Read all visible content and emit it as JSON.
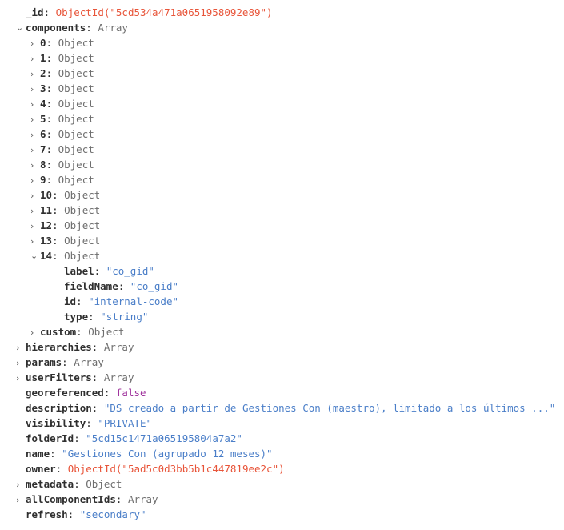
{
  "viewer": {
    "name": "object-tree-inspector",
    "background": "#ffffff",
    "colors": {
      "key": "#2f2f2f",
      "type_label": "#6e6e6e",
      "string": "#4a7ec8",
      "objectid": "#e8553a",
      "boolean": "#a0349e",
      "twisty": "#5a5a5a"
    },
    "icons": {
      "collapsed": "›",
      "expanded": "⌄"
    }
  },
  "rows": [
    {
      "indent": 1,
      "twisty": "none",
      "key": "_id",
      "colon": ":",
      "value": "ObjectId(\"5cd534a471a0651958092e89\")",
      "kind": "oid"
    },
    {
      "indent": 1,
      "twisty": "expanded",
      "key": "components",
      "colon": ":",
      "value": "Array",
      "kind": "type"
    },
    {
      "indent": 2,
      "twisty": "collapsed",
      "key": "0",
      "colon": ":",
      "value": "Object",
      "kind": "type"
    },
    {
      "indent": 2,
      "twisty": "collapsed",
      "key": "1",
      "colon": ":",
      "value": "Object",
      "kind": "type"
    },
    {
      "indent": 2,
      "twisty": "collapsed",
      "key": "2",
      "colon": ":",
      "value": "Object",
      "kind": "type"
    },
    {
      "indent": 2,
      "twisty": "collapsed",
      "key": "3",
      "colon": ":",
      "value": "Object",
      "kind": "type"
    },
    {
      "indent": 2,
      "twisty": "collapsed",
      "key": "4",
      "colon": ":",
      "value": "Object",
      "kind": "type"
    },
    {
      "indent": 2,
      "twisty": "collapsed",
      "key": "5",
      "colon": ":",
      "value": "Object",
      "kind": "type"
    },
    {
      "indent": 2,
      "twisty": "collapsed",
      "key": "6",
      "colon": ":",
      "value": "Object",
      "kind": "type"
    },
    {
      "indent": 2,
      "twisty": "collapsed",
      "key": "7",
      "colon": ":",
      "value": "Object",
      "kind": "type"
    },
    {
      "indent": 2,
      "twisty": "collapsed",
      "key": "8",
      "colon": ":",
      "value": "Object",
      "kind": "type"
    },
    {
      "indent": 2,
      "twisty": "collapsed",
      "key": "9",
      "colon": ":",
      "value": "Object",
      "kind": "type"
    },
    {
      "indent": 2,
      "twisty": "collapsed",
      "key": "10",
      "colon": ":",
      "value": "Object",
      "kind": "type"
    },
    {
      "indent": 2,
      "twisty": "collapsed",
      "key": "11",
      "colon": ":",
      "value": "Object",
      "kind": "type"
    },
    {
      "indent": 2,
      "twisty": "collapsed",
      "key": "12",
      "colon": ":",
      "value": "Object",
      "kind": "type"
    },
    {
      "indent": 2,
      "twisty": "collapsed",
      "key": "13",
      "colon": ":",
      "value": "Object",
      "kind": "type"
    },
    {
      "indent": 2,
      "twisty": "expanded",
      "key": "14",
      "colon": ":",
      "value": "Object",
      "kind": "type"
    },
    {
      "indent": 3,
      "twisty": "none",
      "key": "label",
      "colon": ":",
      "value": "\"co_gid\"",
      "kind": "string"
    },
    {
      "indent": 3,
      "twisty": "none",
      "key": "fieldName",
      "colon": ":",
      "value": "\"co_gid\"",
      "kind": "string"
    },
    {
      "indent": 3,
      "twisty": "none",
      "key": "id",
      "colon": ":",
      "value": "\"internal-code\"",
      "kind": "string"
    },
    {
      "indent": 3,
      "twisty": "none",
      "key": "type",
      "colon": ":",
      "value": "\"string\"",
      "kind": "string"
    },
    {
      "indent": 2,
      "twisty": "collapsed",
      "key": "custom",
      "colon": ":",
      "value": "Object",
      "kind": "type"
    },
    {
      "indent": 1,
      "twisty": "collapsed",
      "key": "hierarchies",
      "colon": ":",
      "value": "Array",
      "kind": "type"
    },
    {
      "indent": 1,
      "twisty": "collapsed",
      "key": "params",
      "colon": ":",
      "value": "Array",
      "kind": "type"
    },
    {
      "indent": 1,
      "twisty": "collapsed",
      "key": "userFilters",
      "colon": ":",
      "value": "Array",
      "kind": "type"
    },
    {
      "indent": 1,
      "twisty": "none",
      "key": "georeferenced",
      "colon": ":",
      "value": "false",
      "kind": "bool"
    },
    {
      "indent": 1,
      "twisty": "none",
      "key": "description",
      "colon": ":",
      "value": "\"DS creado a partir de Gestiones Con (maestro), limitado a los últimos ...\"",
      "kind": "string"
    },
    {
      "indent": 1,
      "twisty": "none",
      "key": "visibility",
      "colon": ":",
      "value": "\"PRIVATE\"",
      "kind": "string"
    },
    {
      "indent": 1,
      "twisty": "none",
      "key": "folderId",
      "colon": ":",
      "value": "\"5cd15c1471a065195804a7a2\"",
      "kind": "string"
    },
    {
      "indent": 1,
      "twisty": "none",
      "key": "name",
      "colon": ":",
      "value": "\"Gestiones Con (agrupado 12 meses)\"",
      "kind": "string"
    },
    {
      "indent": 1,
      "twisty": "none",
      "key": "owner",
      "colon": ":",
      "value": "ObjectId(\"5ad5c0d3bb5b1c447819ee2c\")",
      "kind": "oid"
    },
    {
      "indent": 1,
      "twisty": "collapsed",
      "key": "metadata",
      "colon": ":",
      "value": "Object",
      "kind": "type"
    },
    {
      "indent": 1,
      "twisty": "collapsed",
      "key": "allComponentIds",
      "colon": ":",
      "value": "Array",
      "kind": "type"
    },
    {
      "indent": 1,
      "twisty": "none",
      "key": "refresh",
      "colon": ":",
      "value": "\"secondary\"",
      "kind": "string"
    }
  ]
}
